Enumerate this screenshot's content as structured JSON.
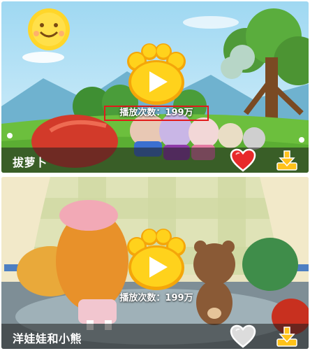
{
  "videos": [
    {
      "title": "拔萝卜",
      "play_count_text": "播放次数：199万",
      "favorited": true,
      "icons": {
        "play": "paw-play-icon",
        "favorite": "heart-icon",
        "download": "download-icon"
      }
    },
    {
      "title": "洋娃娃和小熊",
      "play_count_text": "播放次数：199万",
      "favorited": false,
      "icons": {
        "play": "paw-play-icon",
        "favorite": "heart-icon",
        "download": "download-icon"
      }
    }
  ],
  "colors": {
    "paw_yellow": "#ffd21c",
    "paw_orange": "#f4a60a",
    "heart_active": "#e82a2a",
    "heart_inactive": "#dcdcdc",
    "download_yellow": "#ffc21a",
    "highlight_box": "#e21b1b"
  }
}
